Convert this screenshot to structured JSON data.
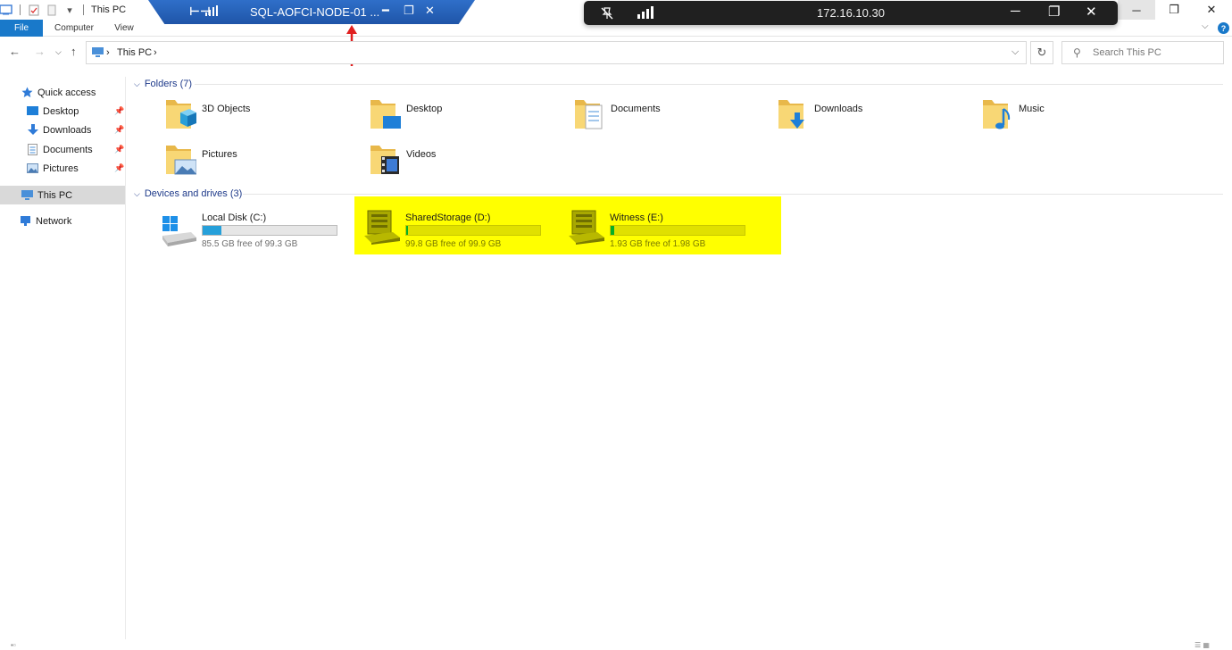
{
  "window": {
    "title": "This PC",
    "controls": {
      "minimize": "─",
      "maximize": "❐",
      "close": "✕"
    }
  },
  "ribbon": {
    "tabs": [
      "File",
      "Computer",
      "View"
    ]
  },
  "rdp_bar": {
    "title": "SQL-AOFCI-NODE-01 ..."
  },
  "remote_bar": {
    "address": "172.16.10.30"
  },
  "address_bar": {
    "crumbs": [
      "This PC"
    ],
    "search_placeholder": "Search This PC"
  },
  "nav_pane": {
    "quick_access": "Quick access",
    "pinned": [
      {
        "label": "Desktop",
        "icon": "desktop-icon"
      },
      {
        "label": "Downloads",
        "icon": "download-icon"
      },
      {
        "label": "Documents",
        "icon": "documents-icon"
      },
      {
        "label": "Pictures",
        "icon": "pictures-icon"
      }
    ],
    "this_pc": "This PC",
    "network": "Network"
  },
  "folders": {
    "header": "Folders (7)",
    "items": [
      {
        "label": "3D Objects",
        "icon": "3d-objects-folder-icon"
      },
      {
        "label": "Desktop",
        "icon": "desktop-folder-icon"
      },
      {
        "label": "Documents",
        "icon": "documents-folder-icon"
      },
      {
        "label": "Downloads",
        "icon": "downloads-folder-icon"
      },
      {
        "label": "Music",
        "icon": "music-folder-icon"
      },
      {
        "label": "Pictures",
        "icon": "pictures-folder-icon"
      },
      {
        "label": "Videos",
        "icon": "videos-folder-icon"
      }
    ]
  },
  "drives": {
    "header": "Devices and drives (3)",
    "items": [
      {
        "label": "Local Disk (C:)",
        "free": "85.5 GB free of 99.3 GB",
        "used_fraction": 0.139
      },
      {
        "label": "SharedStorage (D:)",
        "free": "99.8 GB free of 99.9 GB",
        "used_fraction": 0.001
      },
      {
        "label": "Witness (E:)",
        "free": "1.93 GB free of 1.98 GB",
        "used_fraction": 0.025
      }
    ]
  },
  "colors": {
    "accent": "#1979ca",
    "highlight": "#ffff00",
    "rdp_bar": "#2563c0",
    "remote_bar": "#202020"
  }
}
